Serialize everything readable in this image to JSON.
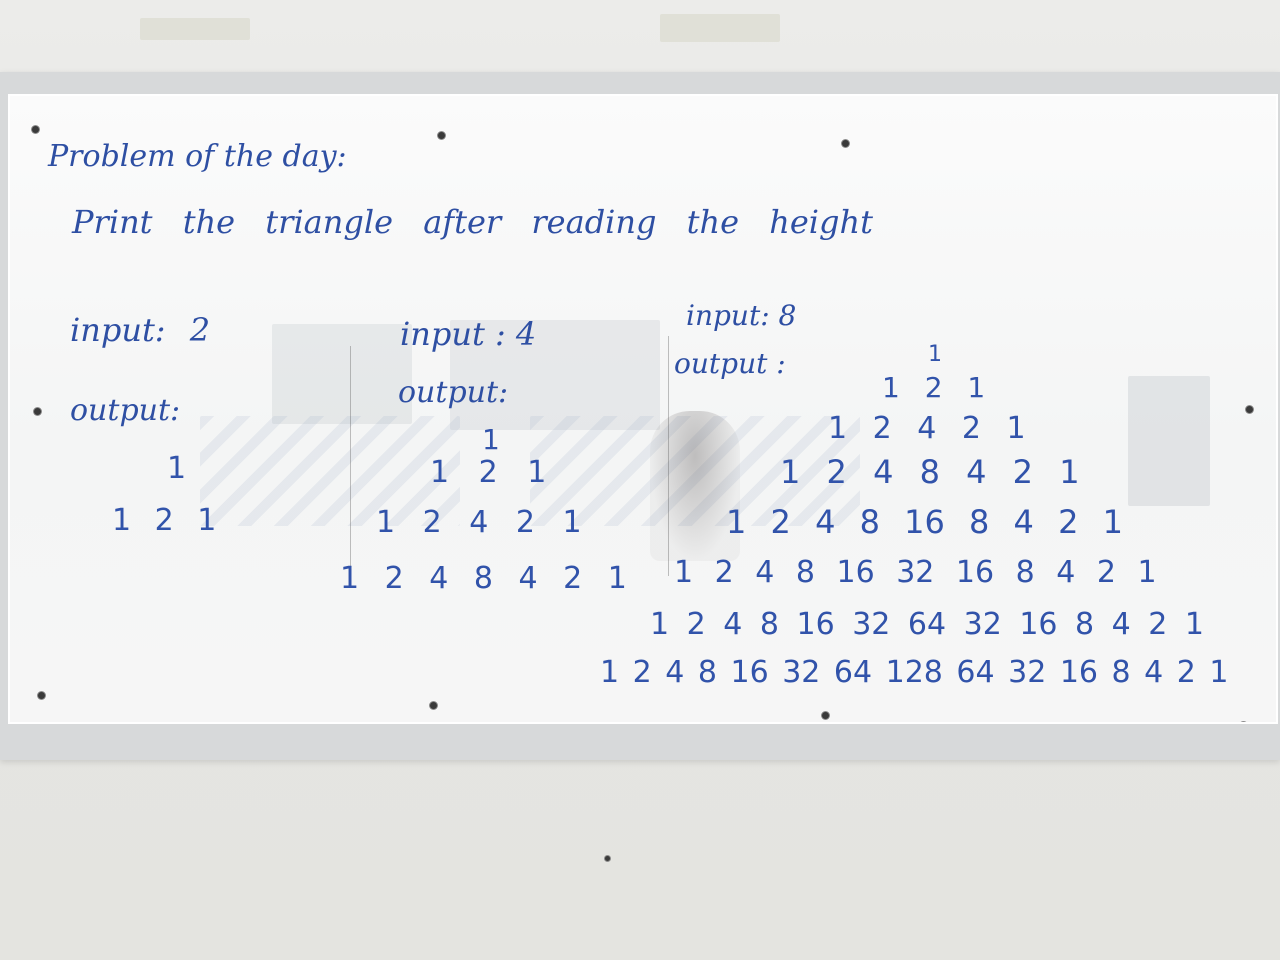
{
  "board": {
    "heading": "Problem of the day:",
    "task": "Print the triangle after reading the height",
    "examples": [
      {
        "input_label": "input: 2",
        "output_label": "output:",
        "rows": [
          "1",
          "1 2 1"
        ]
      },
      {
        "input_label": "input : 4",
        "output_label": "output:",
        "rows": [
          "1",
          "1 2 1",
          "1 2 4 2 1",
          "1 2 4 8 4 2 1"
        ]
      },
      {
        "input_label": "input: 8",
        "output_label": "output :",
        "rows": [
          "1",
          "1 2 1",
          "1 2 4 2 1",
          "1 2 4 8 4 2 1",
          "1 2 4 8 16 8 4 2 1",
          "1 2 4 8 16 32 16 8 4 2 1",
          "1 2 4 8 16 32 64 32 16 8 4 2 1",
          "1 2 4 8 16 32 64 128 64 32 16 8 4 2 1"
        ]
      }
    ],
    "ink_color": "#2e4fa3"
  }
}
